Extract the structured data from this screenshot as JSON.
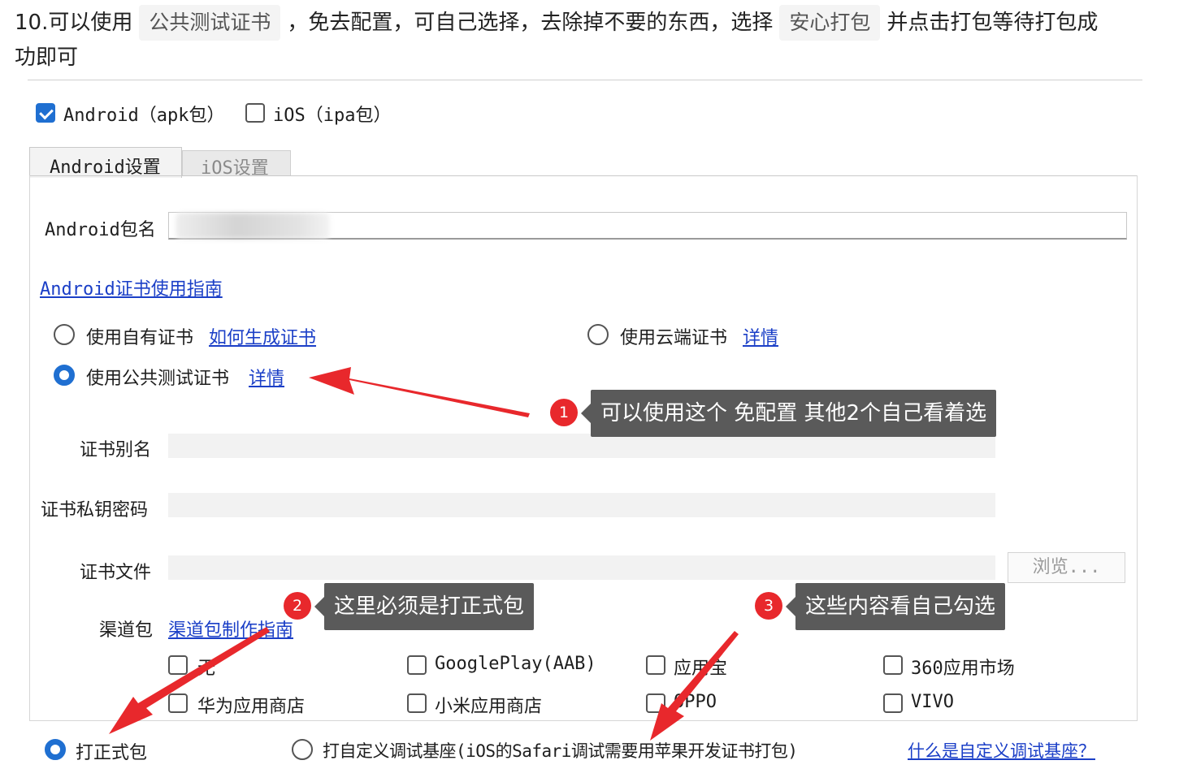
{
  "article": {
    "part1": "10.可以使用",
    "code1": "公共测试证书",
    "part2": "，免去配置，可自己选择，去除掉不要的东西，选择",
    "code2": "安心打包",
    "part3": "并点击打包等待打包成",
    "line2": "功即可"
  },
  "platform": {
    "android_label": "Android（apk包）",
    "ios_label": "iOS（ipa包）",
    "android_checked": true,
    "ios_checked": false
  },
  "tabs": [
    {
      "label": "Android设置",
      "active": true
    },
    {
      "label": "iOS设置",
      "active": false
    }
  ],
  "form": {
    "package_name_label": "Android包名",
    "cert_guide_link": "Android证书使用指南",
    "cert_options": {
      "own": {
        "label": "使用自有证书",
        "link": "如何生成证书",
        "selected": false
      },
      "cloud": {
        "label": "使用云端证书",
        "link": "详情",
        "selected": false
      },
      "public": {
        "label": "使用公共测试证书",
        "link": "详情",
        "selected": true
      }
    },
    "alias_label": "证书别名",
    "key_password_label": "证书私钥密码",
    "cert_file_label": "证书文件",
    "browse_button": "浏览...",
    "channel_label": "渠道包",
    "channel_guide_link": "渠道包制作指南",
    "channels": [
      {
        "label": "无",
        "checked": false
      },
      {
        "label": "GooglePlay(AAB)",
        "checked": false
      },
      {
        "label": "应用宝",
        "checked": false
      },
      {
        "label": "360应用市场",
        "checked": false
      },
      {
        "label": "华为应用商店",
        "checked": false
      },
      {
        "label": "小米应用商店",
        "checked": false
      },
      {
        "label": "OPPO",
        "checked": false
      },
      {
        "label": "VIVO",
        "checked": false
      }
    ]
  },
  "build_type": {
    "release_label": "打正式包",
    "release_selected": true,
    "custom_base_label": "打自定义调试基座(iOS的Safari调试需要用苹果开发证书打包)",
    "custom_base_selected": false,
    "custom_base_link": "什么是自定义调试基座？"
  },
  "annotations": [
    {
      "number": "1",
      "text": "可以使用这个 免配置 其他2个自己看着选"
    },
    {
      "number": "2",
      "text": "这里必须是打正式包"
    },
    {
      "number": "3",
      "text": "这些内容看自己勾选"
    }
  ],
  "colors": {
    "accent": "#1f6fd1",
    "annotation": "#e8282c",
    "callout_bg": "#5a5a5a",
    "link": "#1b3fc7"
  }
}
